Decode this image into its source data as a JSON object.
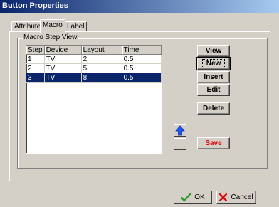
{
  "window": {
    "title": "Button Properties"
  },
  "tabs": [
    {
      "label": "Attribute"
    },
    {
      "label": "Macro"
    },
    {
      "label": "Label"
    }
  ],
  "group": {
    "label": "Macro Step View"
  },
  "table": {
    "columns": [
      "Step",
      "Device",
      "Layout",
      "Time"
    ],
    "rows": [
      {
        "step": "1",
        "device": "TV",
        "layout": "2",
        "time": "0.5"
      },
      {
        "step": "2",
        "device": "TV",
        "layout": "5",
        "time": "0.5"
      },
      {
        "step": "3",
        "device": "TV",
        "layout": "8",
        "time": "0.5"
      }
    ],
    "selected_index": 2
  },
  "buttons": {
    "view": "View",
    "new": "New",
    "insert": "Insert",
    "edit": "Edit",
    "delete": "Delete",
    "save": "Save",
    "ok": "OK",
    "cancel": "Cancel"
  },
  "icons": {
    "move_up": "up-arrow-icon",
    "ok": "checkmark-icon",
    "cancel": "x-icon"
  },
  "colors": {
    "titlebar_start": "#0a246a",
    "titlebar_end": "#a6caf0",
    "selection": "#0a246a",
    "save_text": "#e00000",
    "arrow": "#1a5cff",
    "check": "#2e9a2e",
    "cross": "#d01010"
  }
}
